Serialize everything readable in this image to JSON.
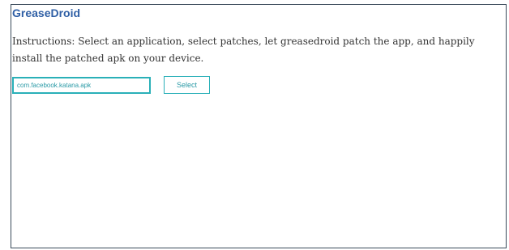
{
  "app": {
    "title": "GreaseDroid"
  },
  "main": {
    "instructions": "Instructions: Select an application, select patches, let greasedroid patch the app, and happily install the patched apk on your device.",
    "apk_input_value": "com.facebook.katana.apk",
    "select_button_label": "Select"
  },
  "colors": {
    "title": "#2f5fa5",
    "accent": "#2ab0b8",
    "frame_border": "#3a4a5a"
  }
}
